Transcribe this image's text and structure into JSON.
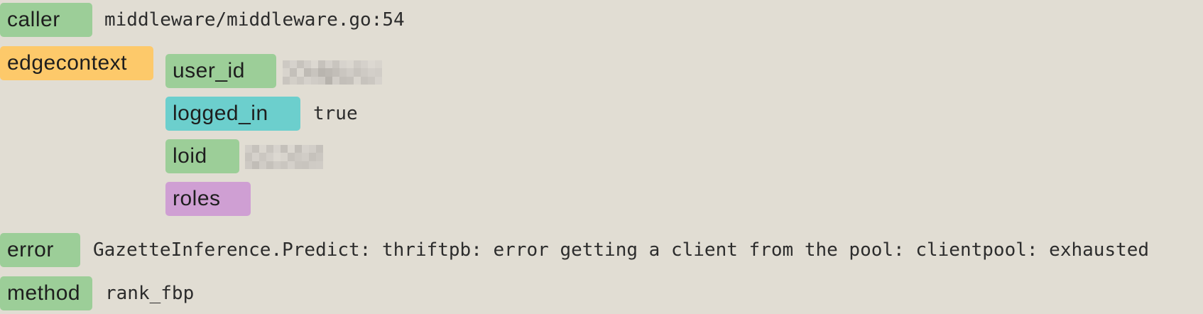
{
  "rows": {
    "caller": {
      "key": "caller",
      "value": "middleware/middleware.go:54"
    },
    "edgecontext": {
      "key": "edgecontext",
      "fields": {
        "user_id": {
          "key": "user_id",
          "value_redacted": true
        },
        "logged_in": {
          "key": "logged_in",
          "value": "true"
        },
        "loid": {
          "key": "loid",
          "value_redacted": true
        },
        "roles": {
          "key": "roles"
        }
      }
    },
    "error": {
      "key": "error",
      "value": "GazetteInference.Predict: thriftpb: error getting a client from the pool: clientpool: exhausted"
    },
    "method": {
      "key": "method",
      "value": "rank_fbp"
    }
  },
  "colors": {
    "background": "#e1ddd3",
    "badge_green": "#9cce98",
    "badge_yellow": "#fdc96a",
    "badge_cyan": "#6ccfcd",
    "badge_purple": "#cf9fd3"
  }
}
